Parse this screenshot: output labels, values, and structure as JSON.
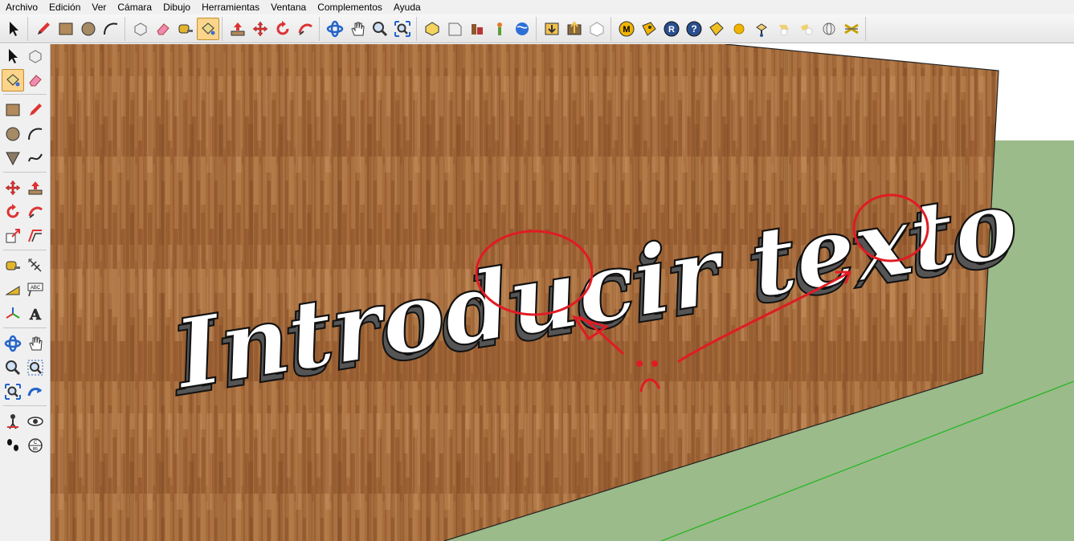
{
  "menu": {
    "items": [
      "Archivo",
      "Edición",
      "Ver",
      "Cámara",
      "Dibujo",
      "Herramientas",
      "Ventana",
      "Complementos",
      "Ayuda"
    ]
  },
  "toolbar": {
    "groups": [
      [
        "select-arrow-icon"
      ],
      [
        "pencil-icon",
        "rectangle-icon",
        "circle-icon",
        "arc-icon"
      ],
      [
        "make-component-icon",
        "eraser-icon",
        "tape-measure-icon",
        "paint-bucket-icon"
      ],
      [
        "push-pull-icon",
        "move-icon",
        "rotate-icon",
        "follow-me-icon"
      ],
      [
        "orbit-icon",
        "pan-hand-icon",
        "zoom-icon",
        "zoom-extents-icon"
      ],
      [
        "get-models-icon",
        "share-model-icon",
        "components-icon",
        "geolocation-icon",
        "google-earth-icon"
      ],
      [
        "import-icon",
        "export-icon",
        "photo-match-icon"
      ],
      [
        "plugin-m-icon",
        "plugin-tag-icon",
        "plugin-r-icon",
        "help-icon",
        "plugin-label-icon",
        "sphere-icon",
        "lamp-icon",
        "light-icon",
        "light2-icon",
        "globe-icon",
        "cross-icon"
      ]
    ]
  },
  "side_toolbar": {
    "rows": [
      [
        "select-arrow-icon",
        "make-component-icon"
      ],
      [
        "paint-bucket-icon",
        "eraser-icon"
      ],
      [
        "rectangle-icon",
        "line-icon"
      ],
      [
        "circle-icon",
        "arc-icon"
      ],
      [
        "polygon-icon",
        "freehand-icon"
      ],
      [
        "move-icon",
        "push-pull-icon"
      ],
      [
        "rotate-icon",
        "follow-me-icon"
      ],
      [
        "scale-icon",
        "offset-icon"
      ],
      [
        "tape-measure-icon",
        "dimension-icon"
      ],
      [
        "protractor-icon",
        "text-icon"
      ],
      [
        "axes-icon",
        "3d-text-icon"
      ],
      [
        "orbit-icon",
        "pan-hand-icon"
      ],
      [
        "zoom-icon",
        "zoom-window-icon"
      ],
      [
        "zoom-extents-icon",
        "previous-view-icon"
      ],
      [
        "position-camera-icon",
        "look-around-icon"
      ],
      [
        "walk-icon",
        "section-plane-icon"
      ]
    ]
  },
  "scene": {
    "text_3d": "Introducir texto",
    "smiley": "sad-face",
    "colors": {
      "sky": "#ffffff",
      "ground": "#9bbb8a",
      "wood": "#a8693a",
      "annotation": "#e01b24",
      "axis_green": "#1db61d"
    }
  }
}
